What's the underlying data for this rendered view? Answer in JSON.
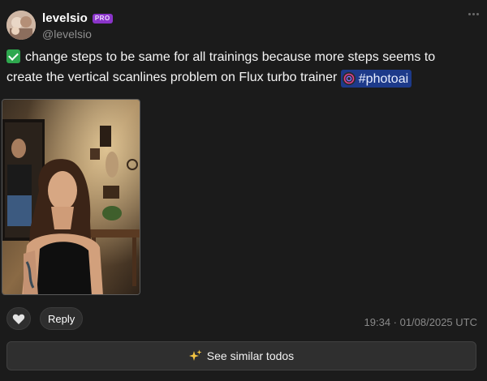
{
  "post": {
    "author": {
      "name": "levelsio",
      "badge": "PRO",
      "handle": "@levelsio"
    },
    "text": "change steps to be same for all trainings because more steps seems to create the vertical scanlines problem on Flux turbo trainer",
    "tag": "#photoai",
    "timestamp": "19:34 · 01/08/2025 UTC"
  },
  "actions": {
    "reply_label": "Reply",
    "similar_label": "See similar todos"
  },
  "icons": [
    "more-icon",
    "check-icon",
    "photoai-logo-icon",
    "heart-icon",
    "sparkle-icon"
  ],
  "colors": {
    "background": "#1b1b1b",
    "pro_badge": "#8a34c9",
    "check": "#2ea84e",
    "tag": "#1d3a8a",
    "sparkle": "#f5c542"
  }
}
